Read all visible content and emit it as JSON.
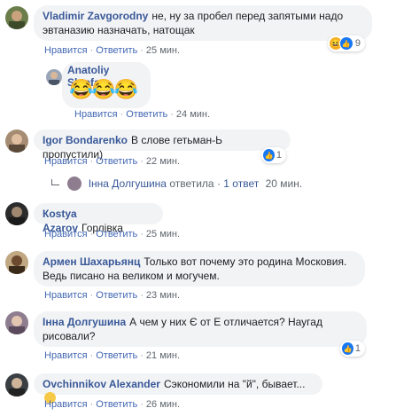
{
  "colors": {
    "link": "#385898",
    "action": "#4267b2",
    "bubble": "#f2f3f5",
    "meta": "#606770"
  },
  "comments": [
    {
      "name": "Vladimir Zavgorodny",
      "text": "не, ну за пробел перед запятыми надо эвтаназию назначать, натощак",
      "like": "Нравится",
      "reply": "Ответить",
      "time": "25 мин.",
      "reaction_count": "9",
      "reaction_icons": [
        "haha-icon",
        "like-icon"
      ]
    },
    {
      "name": "Anatoliy Shtefan",
      "text": "",
      "like": "Нравится",
      "reply": "Ответить",
      "time": "24 мин.",
      "emoji_count": 3
    },
    {
      "name": "Igor Bondarenko",
      "text": "В слове гетьман-Ь пропустили)",
      "like": "Нравится",
      "reply": "Ответить",
      "time": "22 мин.",
      "reaction_count": "1",
      "reaction_icons": [
        "like-icon"
      ]
    },
    {
      "name": "Кostya Azarov",
      "text": "Горлівка",
      "like": "Нравится",
      "reply": "Ответить",
      "time": "25 мин."
    },
    {
      "name": "Армен Шахарьянц",
      "text": "Только вот почему это родина Московия. Ведь писано на великом и могучем.",
      "like": "Нравится",
      "reply": "Ответить",
      "time": "23 мин."
    },
    {
      "name": "Інна Долгушина",
      "text": "А чем у них Є от Е отличается? Наугад рисовали?",
      "like": "Нравится",
      "reply": "Ответить",
      "time": "21 мин.",
      "reaction_count": "1",
      "reaction_icons": [
        "like-icon"
      ]
    },
    {
      "name": "Ovchinnikov Alexander",
      "text": "Сэкономили на \"й\", бывает...",
      "like": "Нравится",
      "reply": "Ответить",
      "time": "26 мин."
    }
  ],
  "thread_reply": {
    "name": "Інна Долгушина",
    "verb": "ответила",
    "count": "1 ответ",
    "time": "20 мин."
  }
}
